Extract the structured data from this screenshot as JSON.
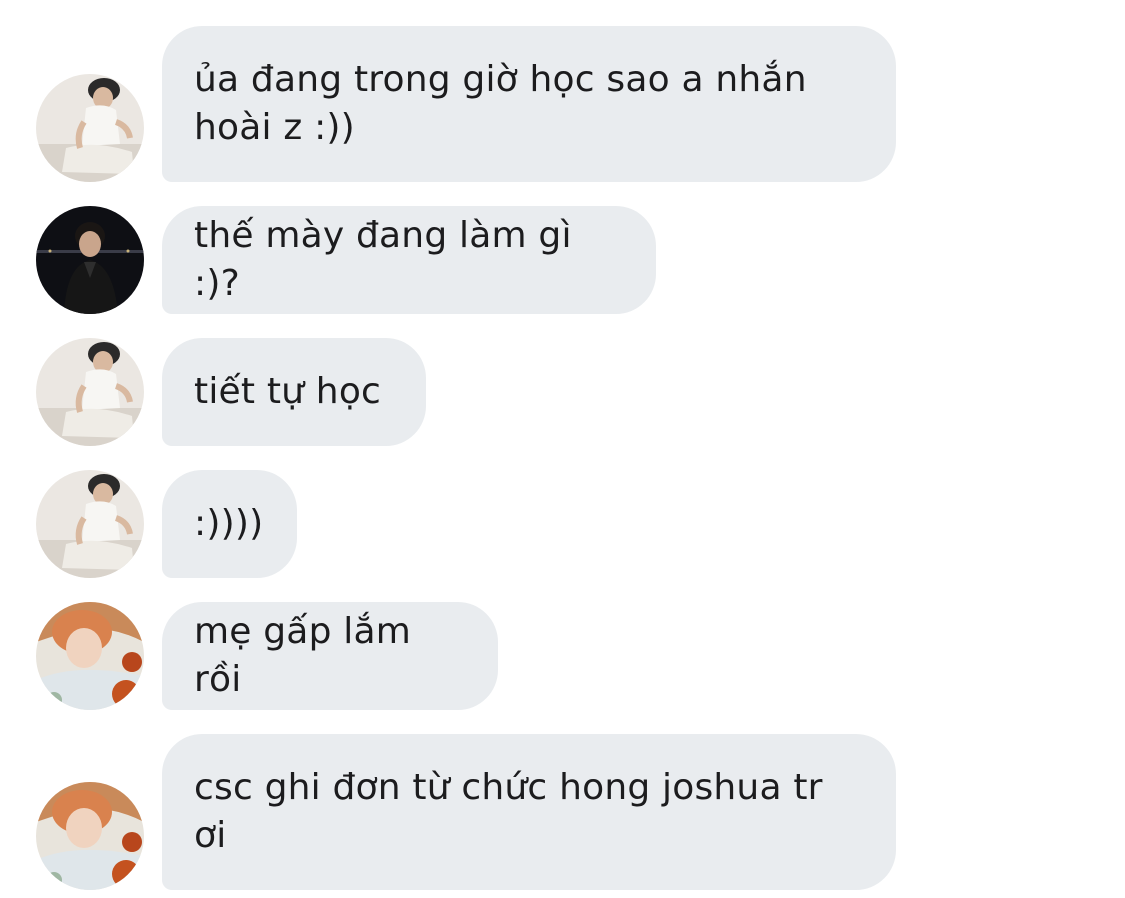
{
  "messages": [
    {
      "avatar": "avatar-white-shirt-icon",
      "text": "ủa đang trong giờ học sao a nhắn\nhoài z :))"
    },
    {
      "avatar": "avatar-dark-night-icon",
      "text": "thế mày đang làm gì :)?"
    },
    {
      "avatar": "avatar-white-shirt-icon",
      "text": "tiết tự học"
    },
    {
      "avatar": "avatar-white-shirt-icon",
      "text": ":))))"
    },
    {
      "avatar": "avatar-orange-hair-icon",
      "text": "mẹ gấp lắm rồi"
    },
    {
      "avatar": "avatar-orange-hair-icon",
      "text": "csc ghi đơn từ chức hong joshua tr\nơi"
    }
  ],
  "colors": {
    "bubble_background": "#e9ecef",
    "text": "#1c1c1e",
    "page_background": "#ffffff"
  }
}
